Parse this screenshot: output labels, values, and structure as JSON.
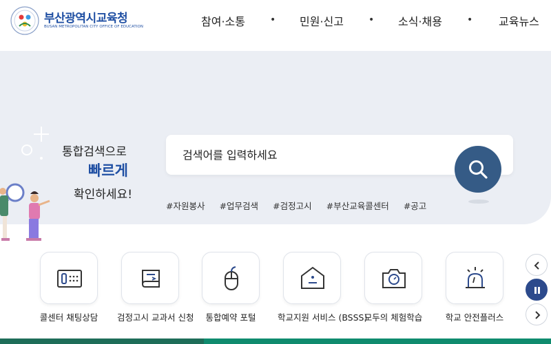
{
  "header": {
    "logo_title": "부산광역시교육청",
    "logo_subtitle": "BUSAN METROPOLITAN CITY OFFICE OF EDUCATION",
    "nav": [
      "참여·소통",
      "민원·신고",
      "소식·채용",
      "교육뉴스"
    ],
    "separator": "•"
  },
  "hero": {
    "line1": "통합검색으로",
    "line2": "빠르게",
    "line3": "확인하세요!"
  },
  "search": {
    "placeholder": "검색어를 입력하세요"
  },
  "tags": [
    "#자원봉사",
    "#업무검색",
    "#검정고시",
    "#부산교육콜센터",
    "#공고"
  ],
  "quick_menu": [
    {
      "label": "콜센터 채팅상담",
      "icon": "chat-terminal-icon"
    },
    {
      "label": "검정고시 교과서 신청",
      "icon": "book-icon"
    },
    {
      "label": "통합예약 포털",
      "icon": "mouse-icon"
    },
    {
      "label": "학교지원 서비스 (BSSS)",
      "icon": "school-support-icon"
    },
    {
      "label": "모두의 체험학습",
      "icon": "camera-icon"
    },
    {
      "label": "학교 안전플러스",
      "icon": "siren-icon"
    }
  ],
  "colors": {
    "brand": "#1f4fa3",
    "search_button": "#355b86",
    "hero_bg": "#ebeef4",
    "footer_bar": "#0f8b6e"
  }
}
